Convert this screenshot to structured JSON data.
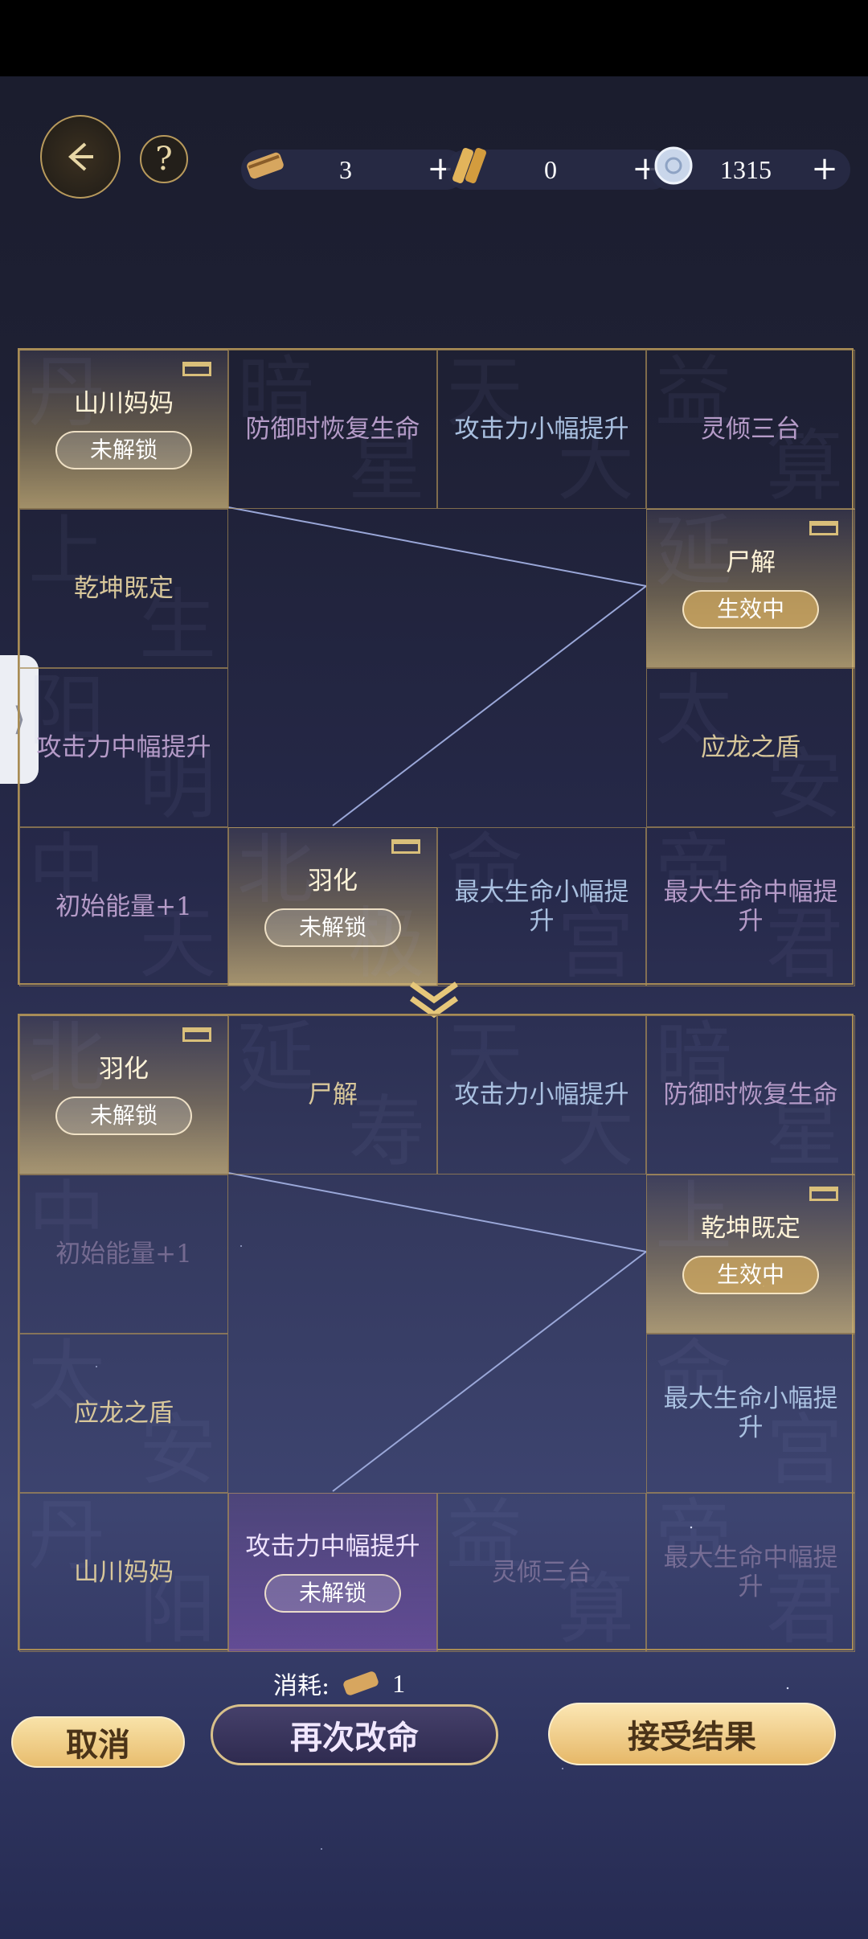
{
  "header": {
    "resources": [
      {
        "icon": "scroll-icon",
        "value": "3"
      },
      {
        "icon": "bamboo-slips-icon",
        "value": "0"
      },
      {
        "icon": "jade-coin-icon",
        "value": "1315"
      }
    ]
  },
  "board_before": {
    "cells": [
      {
        "label": "山川妈妈",
        "status": "未解锁",
        "style": "gold",
        "bg": [
          "丹",
          ""
        ]
      },
      {
        "label": "防御时恢复生命",
        "status": "",
        "style": "purple",
        "bg": [
          "暗",
          "星"
        ]
      },
      {
        "label": "攻击力小幅提升",
        "status": "",
        "style": "blue",
        "bg": [
          "天",
          "大"
        ]
      },
      {
        "label": "灵倾三台",
        "status": "",
        "style": "purple",
        "bg": [
          "益",
          "算"
        ]
      },
      {
        "label": "乾坤既定",
        "status": "",
        "style": "gold-text",
        "bg": [
          "上",
          "生"
        ]
      },
      {
        "label": "尸解",
        "status": "生效中",
        "style": "gold",
        "bg": [
          "延",
          ""
        ]
      },
      {
        "label": "攻击力中幅提升",
        "status": "",
        "style": "purple",
        "bg": [
          "阳",
          "明"
        ]
      },
      {
        "label": "应龙之盾",
        "status": "",
        "style": "gold-text",
        "bg": [
          "太",
          "安"
        ]
      },
      {
        "label": "初始能量+1",
        "status": "",
        "style": "purple",
        "bg": [
          "中",
          "天"
        ]
      },
      {
        "label": "羽化",
        "status": "未解锁",
        "style": "gold",
        "bg": [
          "北",
          "极"
        ]
      },
      {
        "label": "最大生命小幅提升",
        "status": "",
        "style": "blue",
        "bg": [
          "命",
          "宫"
        ]
      },
      {
        "label": "最大生命中幅提升",
        "status": "",
        "style": "purple",
        "bg": [
          "帝",
          "君"
        ]
      }
    ]
  },
  "board_after": {
    "cells": [
      {
        "label": "羽化",
        "status": "未解锁",
        "style": "gold",
        "bg": [
          "北",
          ""
        ]
      },
      {
        "label": "尸解",
        "status": "",
        "style": "gold-text",
        "bg": [
          "延",
          "寿"
        ]
      },
      {
        "label": "攻击力小幅提升",
        "status": "",
        "style": "blue",
        "bg": [
          "天",
          "大"
        ]
      },
      {
        "label": "防御时恢复生命",
        "status": "",
        "style": "purple",
        "bg": [
          "暗",
          "星"
        ]
      },
      {
        "label": "初始能量+1",
        "status": "",
        "style": "dim",
        "bg": [
          "中",
          ""
        ]
      },
      {
        "label": "乾坤既定",
        "status": "生效中",
        "style": "gold",
        "bg": [
          "上",
          ""
        ]
      },
      {
        "label": "应龙之盾",
        "status": "",
        "style": "gold-text",
        "bg": [
          "太",
          "安"
        ]
      },
      {
        "label": "最大生命小幅提升",
        "status": "",
        "style": "blue",
        "bg": [
          "命",
          "宫"
        ]
      },
      {
        "label": "山川妈妈",
        "status": "",
        "style": "gold-text",
        "bg": [
          "丹",
          "阳"
        ]
      },
      {
        "label": "攻击力中幅提升",
        "status": "未解锁",
        "style": "violet",
        "bg": [
          "",
          ""
        ]
      },
      {
        "label": "灵倾三台",
        "status": "",
        "style": "dim",
        "bg": [
          "益",
          "算"
        ]
      },
      {
        "label": "最大生命中幅提升",
        "status": "",
        "style": "dim",
        "bg": [
          "帝",
          "君"
        ]
      }
    ]
  },
  "footer": {
    "cost_label": "消耗:",
    "cost_value": "1",
    "cancel_label": "取消",
    "retry_label": "再次改命",
    "accept_label": "接受结果"
  }
}
